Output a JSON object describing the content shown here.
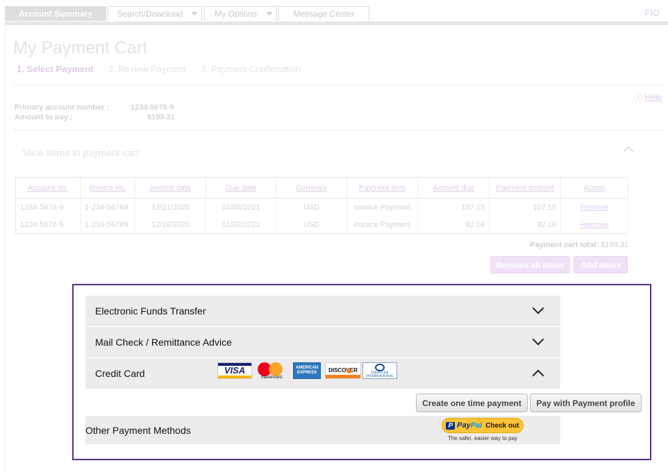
{
  "nav": {
    "tabs": [
      {
        "label": "Account Summary"
      },
      {
        "label": "Search/Download"
      },
      {
        "label": "My Options"
      },
      {
        "label": "Message Center"
      }
    ],
    "brand": "FIO"
  },
  "page": {
    "title": "My Payment Cart",
    "steps": [
      "1.  Select Payment",
      "2.  Review Payment",
      "3.  Payment Confirmation"
    ],
    "help": "Help"
  },
  "account": {
    "primary_label": "Primary account number :",
    "primary_value": "1234-5678-9",
    "amount_label": "Amount to pay :",
    "amount_value": "$199.31"
  },
  "cart": {
    "heading": "View items in payment cart",
    "columns": [
      "Account no.",
      "Invoice no.",
      "Invoice date",
      "Due date",
      "Currency",
      "Payment item",
      "Amount due",
      "Payment amount",
      "Action"
    ],
    "rows": [
      [
        "1234-5678-9",
        "1-234-56789",
        "12/21/2020",
        "01/05/2021",
        "USD",
        "Invoice Payment",
        "107.15",
        "107.15",
        "Remove"
      ],
      [
        "1234-5678-9",
        "1-234-56789",
        "12/18/2020",
        "01/02/2021",
        "USD",
        "Invoice Payment",
        "92.16",
        "92.16",
        "Remove"
      ]
    ],
    "total_label": "Payment cart total:",
    "total_value": "$199.31",
    "remove_all": "Remove all items",
    "add_items": "Add items"
  },
  "payment_methods": {
    "eft": "Electronic Funds Transfer",
    "mail_check": "Mail Check / Remittance Advice",
    "credit_card": "Credit Card",
    "cards": [
      "VISA",
      "mastercard",
      "AMERICAN EXPRESS",
      "DISCOVER",
      "Diners Club INTERNATIONAL"
    ],
    "create_one_time": "Create one time payment",
    "pay_with_profile": "Pay with Payment profile",
    "other": "Other Payment Methods",
    "paypal_checkout": "Check out",
    "paypal_tagline": "The safer, easier way to pay"
  },
  "colors": {
    "focus_border": "#5a2d7e",
    "accordion_bg": "#ececec",
    "faded_accent": "#dccbe8"
  }
}
